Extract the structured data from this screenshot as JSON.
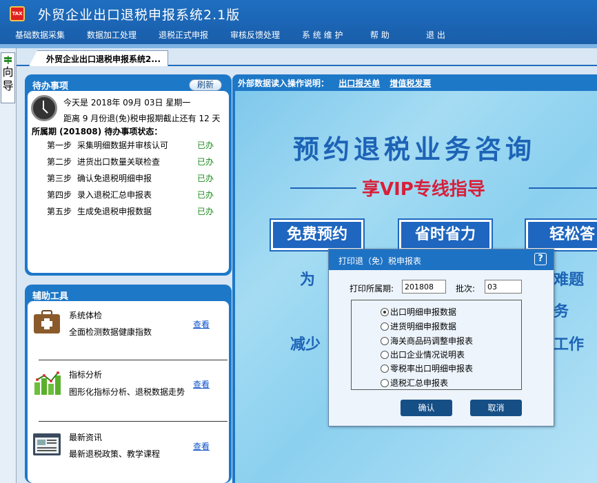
{
  "window": {
    "title": "外贸企业出口退税申报系统2.1版",
    "icon_text": "TAX"
  },
  "menu": [
    "基础数据采集",
    "数据加工处理",
    "退税正式申报",
    "审核反馈处理",
    "系 统 维 护",
    "帮 助",
    "退 出"
  ],
  "left_nav": {
    "label_1": "向",
    "label_2": "导"
  },
  "tab": {
    "label": "外贸企业出口退税申报系统2..."
  },
  "todo": {
    "title": "待办事项",
    "refresh": "刷新",
    "today": "今天是  2018年 09月 03日  星期一",
    "deadline": "距离 9 月份退(免)税申报期截止还有 12 天",
    "period_status": "所属期 (201808) 待办事项状态：",
    "steps": [
      {
        "step": "第一步",
        "text": "采集明细数据并审核认可",
        "status": "已办"
      },
      {
        "step": "第二步",
        "text": "进货出口数量关联检查",
        "status": "已办"
      },
      {
        "step": "第三步",
        "text": "确认免退税明细申报",
        "status": "已办"
      },
      {
        "step": "第四步",
        "text": "录入退税汇总申报表",
        "status": "已办"
      },
      {
        "step": "第五步",
        "text": "生成免退税申报数据",
        "status": "已办"
      }
    ]
  },
  "tools": {
    "title": "辅助工具",
    "items": [
      {
        "name": "系统体检",
        "desc": "全面检测数据健康指数",
        "link": "查看",
        "icon": "medical-kit-icon"
      },
      {
        "name": "指标分析",
        "desc": "图形化指标分析、退税数据走势",
        "link": "查看",
        "icon": "bar-chart-icon"
      },
      {
        "name": "最新资讯",
        "desc": "最新退税政策、教学课程",
        "link": "查看",
        "icon": "news-icon"
      }
    ]
  },
  "right": {
    "header": "外部数据读入操作说明：",
    "link1": "出口报关单",
    "link2": "增值税发票",
    "banner": {
      "title": "预约退税业务咨询",
      "subtitle": "享VIP专线指导",
      "btn1": "免费预约",
      "btn2": "省时省力",
      "btn3": "轻松答",
      "text1": "为",
      "text2": "作难题",
      "text3": "服务",
      "text4": "减少",
      "text5": "报工作"
    }
  },
  "dialog": {
    "title": "打印退（免）税申报表",
    "help": "?",
    "period_label": "打印所属期:",
    "period_value": "201808",
    "batch_label": "批次:",
    "batch_value": "03",
    "options": [
      {
        "label": "出口明细申报数据",
        "selected": true
      },
      {
        "label": "进货明细申报数据",
        "selected": false
      },
      {
        "label": "海关商品码调整申报表",
        "selected": false
      },
      {
        "label": "出口企业情况说明表",
        "selected": false
      },
      {
        "label": "零税率出口明细申报表",
        "selected": false
      },
      {
        "label": "退税汇总申报表",
        "selected": false
      }
    ],
    "ok": "确认",
    "cancel": "取消"
  },
  "colors": {
    "title_bar": "#1b64b3",
    "panel": "#1e78c8",
    "done": "#1c8a1c",
    "banner_red": "#d81f3a"
  }
}
